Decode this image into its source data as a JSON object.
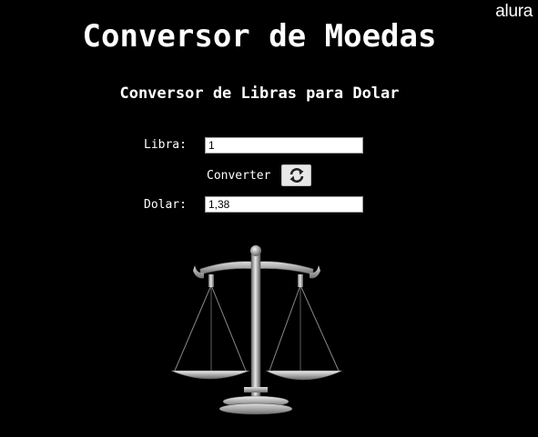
{
  "brand": {
    "name": "alura"
  },
  "header": {
    "title": "Conversor de Moedas",
    "subtitle": "Conversor de Libras para Dolar"
  },
  "form": {
    "libra_label": "Libra:",
    "libra_value": "1",
    "convert_label": "Converter",
    "convert_icon": "refresh-icon",
    "dolar_label": "Dolar:",
    "dolar_value": "1,38"
  },
  "illustration": {
    "icon": "scale-icon"
  },
  "colors": {
    "background": "#000000",
    "text": "#ffffff",
    "field_background": "#ffffff",
    "button_background": "#e8e8e8"
  }
}
